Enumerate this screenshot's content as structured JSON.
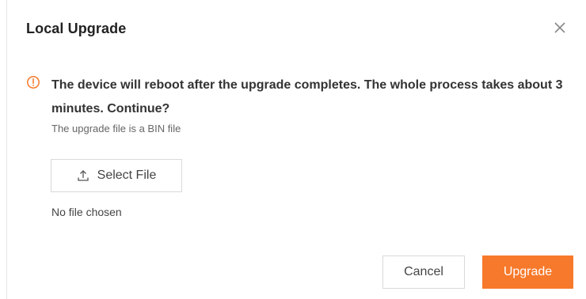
{
  "dialog": {
    "title": "Local Upgrade",
    "close_icon": "close-icon"
  },
  "warning": {
    "icon": "warning-circle-icon",
    "icon_color": "#f7792b",
    "message": "The device will reboot after the upgrade completes. The whole process takes about 3 minutes. Continue?",
    "hint": "The upgrade file is a BIN file"
  },
  "file_picker": {
    "button_label": "Select File",
    "button_icon": "upload-icon",
    "status": "No file chosen"
  },
  "actions": {
    "cancel_label": "Cancel",
    "upgrade_label": "Upgrade",
    "primary_color": "#f7792b"
  }
}
